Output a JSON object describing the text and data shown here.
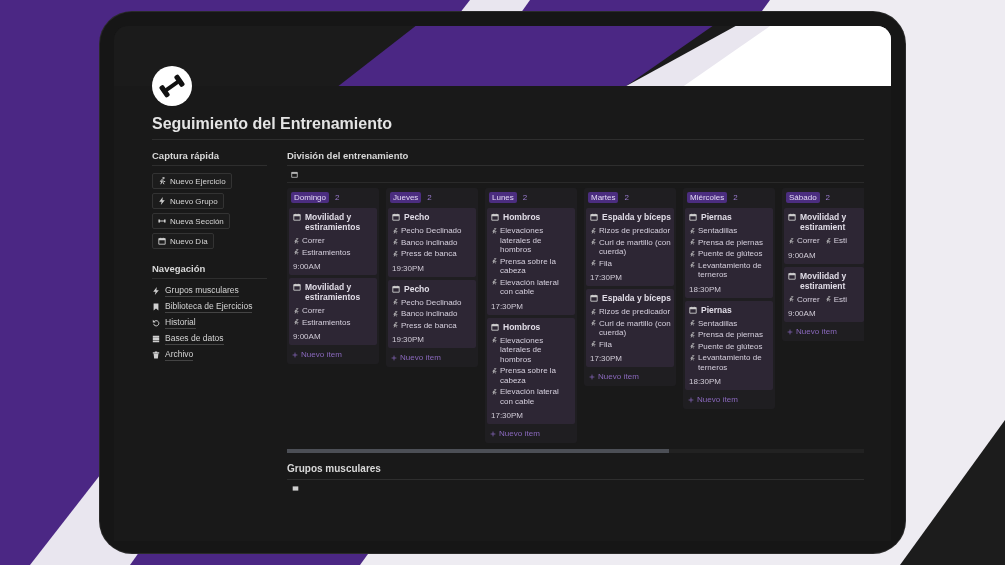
{
  "page": {
    "title": "Seguimiento del Entrenamiento"
  },
  "quick_capture": {
    "heading": "Captura rápida",
    "buttons": [
      {
        "label": "Nuevo Ejercicio"
      },
      {
        "label": "Nuevo Grupo"
      },
      {
        "label": "Nueva Sección"
      },
      {
        "label": "Nuevo Día"
      }
    ]
  },
  "navigation": {
    "heading": "Navegación",
    "items": [
      {
        "label": "Grupos musculares"
      },
      {
        "label": "Biblioteca de Ejercicios"
      },
      {
        "label": "Historial"
      },
      {
        "label": "Bases de datos"
      },
      {
        "label": "Archivo"
      }
    ]
  },
  "board": {
    "heading": "División del entrenamiento",
    "columns": [
      {
        "name": "Domingo",
        "count": "2",
        "new_item": "Nuevo ítem",
        "cards": [
          {
            "kind": "inline",
            "title": "Movilidad y estiramientos",
            "exercises": [
              "Correr",
              "Estiramientos"
            ],
            "time": "9:00AM"
          },
          {
            "kind": "inline",
            "title": "Movilidad y estiramientos",
            "exercises": [
              "Correr",
              "Estiramientos"
            ],
            "time": "9:00AM"
          }
        ]
      },
      {
        "name": "Jueves",
        "count": "2",
        "new_item": "Nuevo ítem",
        "cards": [
          {
            "kind": "stacked",
            "title": "Pecho",
            "exercises": [
              "Pecho Declinado",
              "Banco inclinado",
              "Press de banca"
            ],
            "time": "19:30PM"
          },
          {
            "kind": "stacked",
            "title": "Pecho",
            "exercises": [
              "Pecho Declinado",
              "Banco inclinado",
              "Press de banca"
            ],
            "time": "19:30PM"
          }
        ]
      },
      {
        "name": "Lunes",
        "count": "2",
        "new_item": "Nuevo ítem",
        "cards": [
          {
            "kind": "stacked",
            "title": "Hombros",
            "exercises": [
              "Elevaciones laterales de hombros",
              "Prensa sobre la cabeza",
              "Elevación lateral con cable"
            ],
            "time": "17:30PM"
          },
          {
            "kind": "stacked",
            "title": "Hombros",
            "exercises": [
              "Elevaciones laterales de hombros",
              "Prensa sobre la cabeza",
              "Elevación lateral con cable"
            ],
            "time": "17:30PM"
          }
        ]
      },
      {
        "name": "Martes",
        "count": "2",
        "new_item": "Nuevo ítem",
        "cards": [
          {
            "kind": "stacked",
            "title": "Espalda y bíceps",
            "exercises": [
              "Rizos de predicador",
              "Curl de martillo (con cuerda)",
              "Fila"
            ],
            "time": "17:30PM"
          },
          {
            "kind": "stacked",
            "title": "Espalda y bíceps",
            "exercises": [
              "Rizos de predicador",
              "Curl de martillo (con cuerda)",
              "Fila"
            ],
            "time": "17:30PM"
          }
        ]
      },
      {
        "name": "Miércoles",
        "count": "2",
        "new_item": "Nuevo ítem",
        "cards": [
          {
            "kind": "stacked",
            "title": "Piernas",
            "exercises": [
              "Sentadillas",
              "Prensa de piernas",
              "Puente de glúteos",
              "Levantamiento de terneros"
            ],
            "time": "18:30PM"
          },
          {
            "kind": "stacked",
            "title": "Piernas",
            "exercises": [
              "Sentadillas",
              "Prensa de piernas",
              "Puente de glúteos",
              "Levantamiento de terneros"
            ],
            "time": "18:30PM"
          }
        ]
      },
      {
        "name": "Sábado",
        "count": "2",
        "new_item": "Nuevo ítem",
        "cards": [
          {
            "kind": "inline",
            "title": "Movilidad y estiramient",
            "exercises": [
              "Correr",
              "Esti"
            ],
            "time": "9:00AM"
          },
          {
            "kind": "inline",
            "title": "Movilidad y estiramient",
            "exercises": [
              "Correr",
              "Esti"
            ],
            "time": "9:00AM"
          }
        ]
      }
    ]
  },
  "section": {
    "heading": "Grupos musculares"
  }
}
